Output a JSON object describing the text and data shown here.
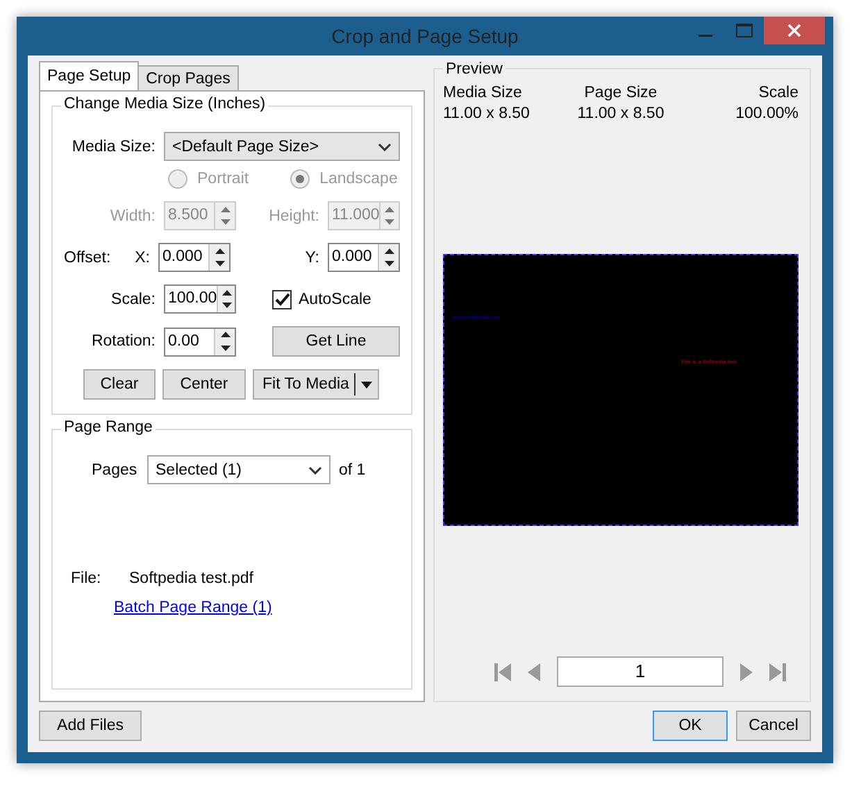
{
  "window": {
    "title": "Crop and Page Setup"
  },
  "tabs": [
    {
      "label": "Page Setup",
      "selected": true
    },
    {
      "label": "Crop Pages",
      "selected": false
    }
  ],
  "media_group": {
    "title": "Change Media Size (Inches)",
    "media_size": {
      "label": "Media Size:",
      "value": "<Default Page Size>"
    },
    "orientation": [
      {
        "label": "Portrait",
        "selected": false,
        "disabled": true
      },
      {
        "label": "Landscape",
        "selected": true,
        "disabled": true
      }
    ],
    "width": {
      "label": "Width:",
      "value": "8.500",
      "disabled": true
    },
    "height": {
      "label": "Height:",
      "value": "11.000",
      "disabled": true
    },
    "offset_label": "Offset:",
    "offset_x": {
      "label": "X:",
      "value": "0.000",
      "disabled": false
    },
    "offset_y": {
      "label": "Y:",
      "value": "0.000",
      "disabled": false
    },
    "scale": {
      "label": "Scale:",
      "value": "100.00",
      "disabled": false
    },
    "autoscale": {
      "label": "AutoScale",
      "checked": true
    },
    "rotation": {
      "label": "Rotation:",
      "value": "0.00",
      "disabled": false
    },
    "get_line": "Get Line",
    "clear": "Clear",
    "center": "Center",
    "fit_to_media": "Fit To Media"
  },
  "page_range": {
    "title": "Page Range",
    "pages_label": "Pages",
    "pages_value": "Selected (1)",
    "of": "of 1",
    "file_label": "File:",
    "file_name": "Softpedia test.pdf",
    "batch_link": "Batch Page Range (1)"
  },
  "preview": {
    "title": "Preview",
    "columns": [
      {
        "heading": "Media Size",
        "value": "11.00 x 8.50"
      },
      {
        "heading": "Page Size",
        "value": "11.00 x 8.50"
      },
      {
        "heading": "Scale",
        "value": "100.00%"
      }
    ],
    "page_texts": [
      "www.softpedia.com",
      "This is a Softpedia test"
    ],
    "page_number": "1"
  },
  "buttons": {
    "add_files": "Add Files",
    "ok": "OK",
    "cancel": "Cancel"
  }
}
